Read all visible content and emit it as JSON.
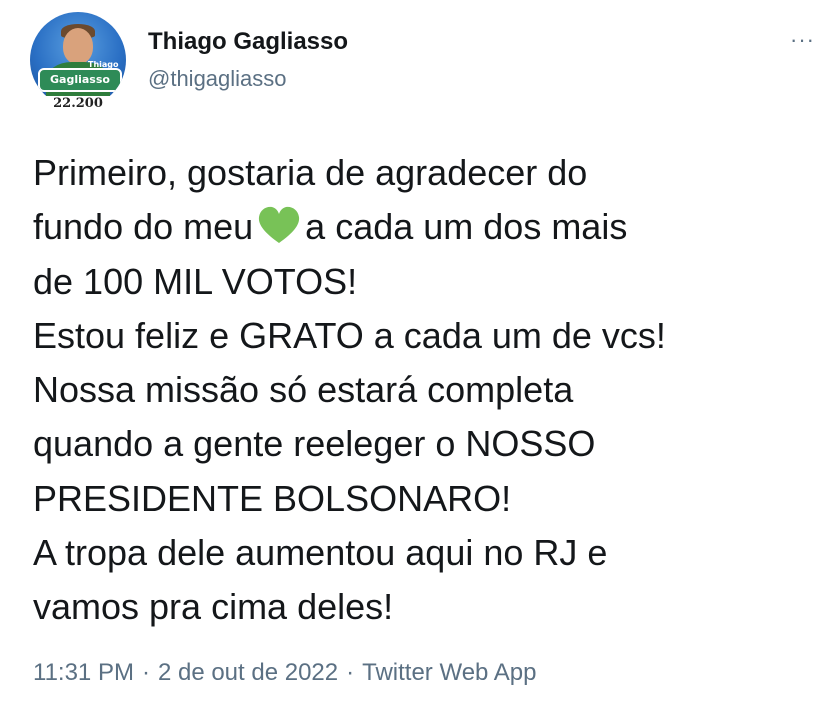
{
  "author": {
    "display_name": "Thiago Gagliasso",
    "handle": "@thigagliasso",
    "avatar_banner_text": "Gagliasso",
    "avatar_banner_small_text": "Thiago",
    "avatar_number": "22.200"
  },
  "menu": {
    "more_icon": "more-horizontal-icon",
    "more_glyph": "···"
  },
  "tweet": {
    "lines": {
      "l1": "Primeiro, gostaria de agradecer do",
      "l2_before": "fundo do meu",
      "l2_after": "a cada um dos mais",
      "l3": "de 100 MIL VOTOS!",
      "l4": "Estou feliz e GRATO a cada um de vcs!",
      "l5": "Nossa missão só estará completa",
      "l6": "quando a gente reeleger o NOSSO",
      "l7": "PRESIDENTE BOLSONARO!",
      "l8": "A tropa dele aumentou aqui no RJ e",
      "l9": "vamos pra cima deles!"
    },
    "emoji_icon": "green-heart-icon",
    "emoji_color": "#78c257"
  },
  "meta": {
    "time": "11:31 PM",
    "date": "2 de out de 2022",
    "source": "Twitter Web App",
    "separator": "·"
  },
  "colors": {
    "text": "#14171a",
    "secondary": "#5b7083",
    "background": "#ffffff"
  }
}
